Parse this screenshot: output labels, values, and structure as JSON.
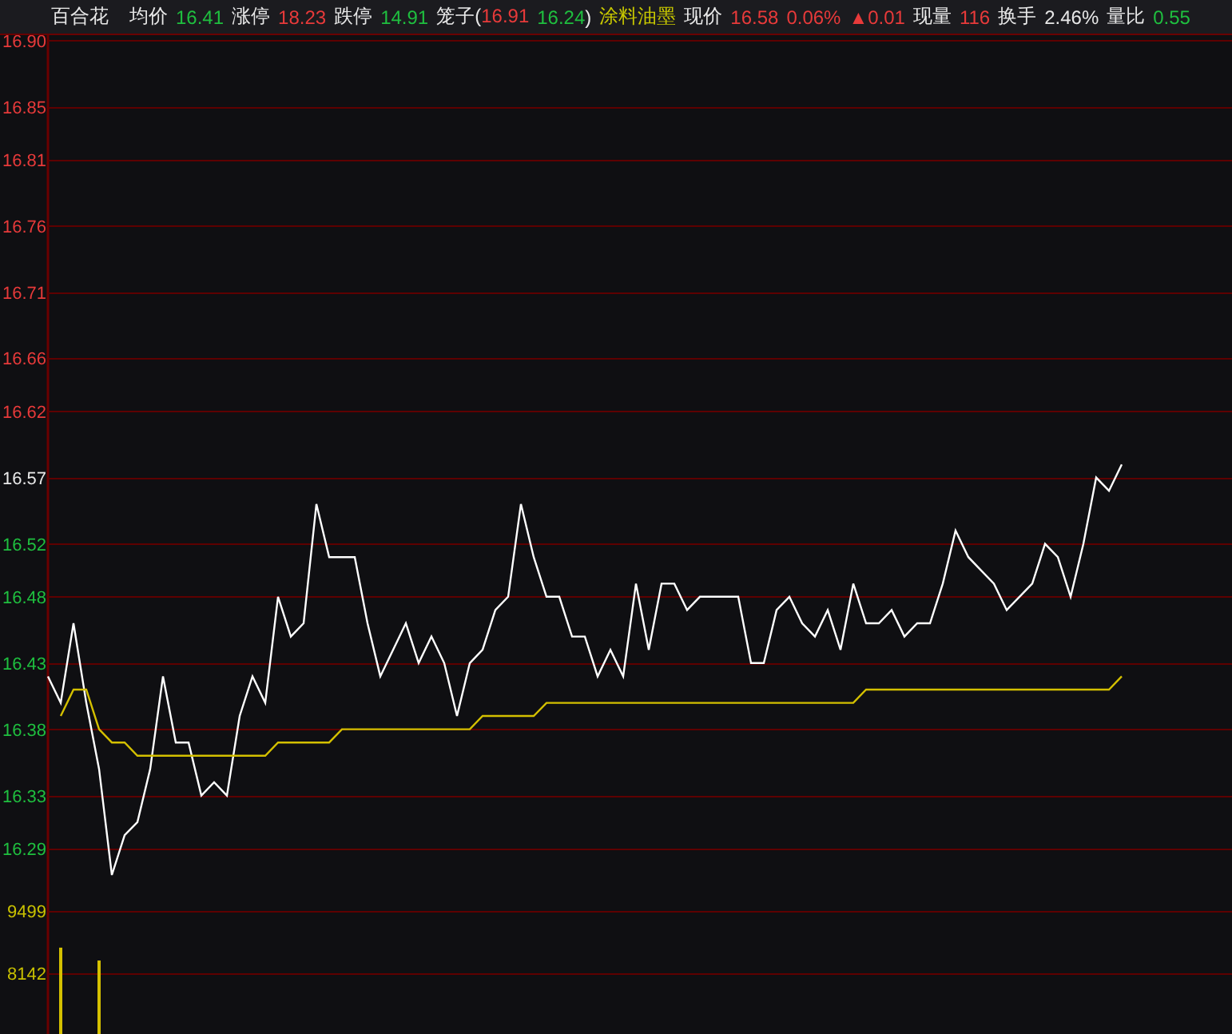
{
  "quote_bar": [
    [
      {
        "text": "百合花",
        "color": "#e8e8e8"
      }
    ],
    [
      {
        "text": "均价",
        "color": "#e8e8e8"
      }
    ],
    [
      {
        "text": "16.41",
        "color": "#1fbf3f"
      }
    ],
    [
      {
        "text": "涨停",
        "color": "#e8e8e8"
      }
    ],
    [
      {
        "text": "18.23",
        "color": "#e83a3a"
      }
    ],
    [
      {
        "text": "跌停",
        "color": "#e8e8e8"
      }
    ],
    [
      {
        "text": "14.91",
        "color": "#1fbf3f"
      }
    ],
    [
      {
        "text": "笼子(",
        "color": "#e8e8e8"
      },
      {
        "text": "16.91",
        "color": "#e83a3a"
      }
    ],
    [
      {
        "text": "16.24",
        "color": "#1fbf3f"
      },
      {
        "text": ")",
        "color": "#e8e8e8"
      }
    ],
    [
      {
        "text": "涂料油墨",
        "color": "#c8c800"
      }
    ],
    [
      {
        "text": "现价",
        "color": "#e8e8e8"
      }
    ],
    [
      {
        "text": "16.58",
        "color": "#e83a3a"
      }
    ],
    [
      {
        "text": "0.06%",
        "color": "#e83a3a"
      }
    ],
    [
      {
        "text": "▲0.01",
        "color": "#e83a3a"
      }
    ],
    [
      {
        "text": "现量",
        "color": "#e8e8e8"
      }
    ],
    [
      {
        "text": "116",
        "color": "#e83a3a"
      }
    ],
    [
      {
        "text": "换手",
        "color": "#e8e8e8"
      }
    ],
    [
      {
        "text": "2.46%",
        "color": "#e8e8e8"
      }
    ],
    [
      {
        "text": "量比",
        "color": "#e8e8e8"
      }
    ],
    [
      {
        "text": "0.55",
        "color": "#1fbf3f"
      }
    ]
  ],
  "price_chart": {
    "chart_data": {
      "type": "line",
      "grid": true,
      "ylim": [
        16.267,
        16.904
      ],
      "yticks": [
        {
          "value": 16.9,
          "label": "16.90"
        },
        {
          "value": 16.85,
          "label": "16.85"
        },
        {
          "value": 16.81,
          "label": "16.81"
        },
        {
          "value": 16.76,
          "label": "16.76"
        },
        {
          "value": 16.71,
          "label": "16.71"
        },
        {
          "value": 16.66,
          "label": "16.66"
        },
        {
          "value": 16.62,
          "label": "16.62"
        },
        {
          "value": 16.57,
          "label": "16.57"
        },
        {
          "value": 16.52,
          "label": "16.52"
        },
        {
          "value": 16.48,
          "label": "16.48"
        },
        {
          "value": 16.43,
          "label": "16.43"
        },
        {
          "value": 16.38,
          "label": "16.38"
        },
        {
          "value": 16.33,
          "label": "16.33"
        },
        {
          "value": 16.29,
          "label": "16.29"
        }
      ],
      "series": [
        {
          "color": "#ffffff",
          "values": [
            16.42,
            16.4,
            16.46,
            16.4,
            16.35,
            16.27,
            16.3,
            16.31,
            16.35,
            16.42,
            16.37,
            16.37,
            16.33,
            16.34,
            16.33,
            16.39,
            16.42,
            16.4,
            16.48,
            16.45,
            16.46,
            16.55,
            16.51,
            16.51,
            16.51,
            16.46,
            16.42,
            16.44,
            16.46,
            16.43,
            16.45,
            16.43,
            16.39,
            16.43,
            16.44,
            16.47,
            16.48,
            16.55,
            16.51,
            16.48,
            16.48,
            16.45,
            16.45,
            16.42,
            16.44,
            16.42,
            16.49,
            16.44,
            16.49,
            16.49,
            16.47,
            16.48,
            16.48,
            16.48,
            16.48,
            16.43,
            16.43,
            16.47,
            16.48,
            16.46,
            16.45,
            16.47,
            16.44,
            16.49,
            16.46,
            16.46,
            16.47,
            16.45,
            16.46,
            16.46,
            16.49,
            16.53,
            16.51,
            16.5,
            16.49,
            16.47,
            16.48,
            16.49,
            16.52,
            16.51,
            16.48,
            16.52,
            16.57,
            16.56,
            16.58
          ]
        },
        {
          "color": "#d4c000",
          "values": [
            null,
            16.39,
            16.41,
            16.41,
            16.38,
            16.37,
            16.37,
            16.36,
            16.36,
            16.36,
            16.36,
            16.36,
            16.36,
            16.36,
            16.36,
            16.36,
            16.36,
            16.36,
            16.37,
            16.37,
            16.37,
            16.37,
            16.37,
            16.38,
            16.38,
            16.38,
            16.38,
            16.38,
            16.38,
            16.38,
            16.38,
            16.38,
            16.38,
            16.38,
            16.39,
            16.39,
            16.39,
            16.39,
            16.39,
            16.4,
            16.4,
            16.4,
            16.4,
            16.4,
            16.4,
            16.4,
            16.4,
            16.4,
            16.4,
            16.4,
            16.4,
            16.4,
            16.4,
            16.4,
            16.4,
            16.4,
            16.4,
            16.4,
            16.4,
            16.4,
            16.4,
            16.4,
            16.4,
            16.4,
            16.41,
            16.41,
            16.41,
            16.41,
            16.41,
            16.41,
            16.41,
            16.41,
            16.41,
            16.41,
            16.41,
            16.41,
            16.41,
            16.41,
            16.41,
            16.41,
            16.41,
            16.41,
            16.41,
            16.41,
            16.42
          ]
        }
      ]
    }
  },
  "volume_chart": {
    "chart_data": {
      "type": "bar",
      "grid": true,
      "ylim": [
        6820,
        10195
      ],
      "yticks": [
        9499,
        8142
      ],
      "series": [
        {
          "color": "#d4c000",
          "values": [
            null,
            8700,
            null,
            null,
            8420,
            null,
            null,
            null,
            null,
            null,
            null,
            null,
            null,
            null,
            null,
            null,
            null,
            null,
            null,
            null,
            null,
            null,
            null,
            null,
            null,
            null,
            null,
            null,
            null,
            null,
            null,
            null,
            null,
            null,
            null,
            null,
            null,
            null,
            null,
            null,
            null,
            null,
            null,
            null,
            null,
            null,
            null,
            null,
            null,
            null,
            null,
            null,
            null,
            null,
            null,
            null,
            null,
            null,
            null,
            null,
            null,
            null,
            null,
            null,
            null,
            null,
            null,
            null,
            null,
            null,
            null,
            null,
            null,
            null,
            null,
            null,
            null,
            null,
            null,
            null,
            null,
            null,
            null,
            null,
            null
          ]
        }
      ]
    }
  }
}
